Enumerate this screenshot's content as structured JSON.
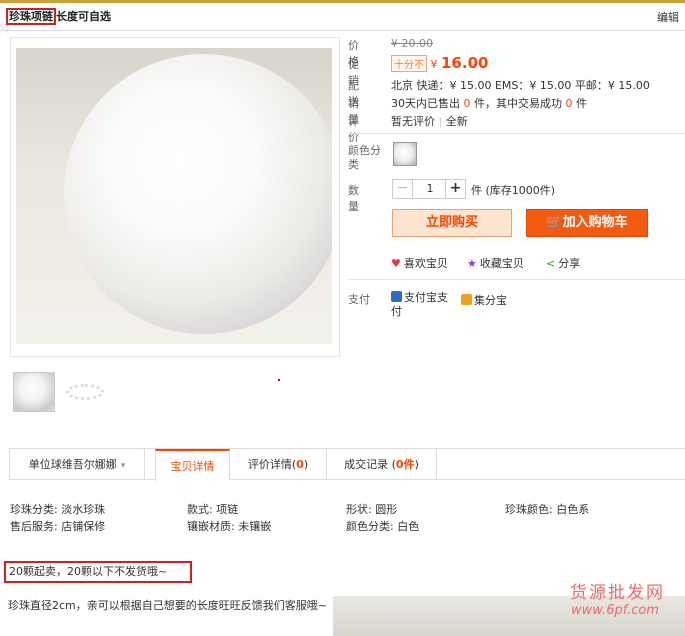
{
  "header": {
    "title_highlight": "珍珠项链",
    "title_rest": "长度可自选",
    "edit_label": "编辑"
  },
  "product": {
    "labels": {
      "price": "价格",
      "promo": "促销",
      "shipping": "配送",
      "sales": "销量",
      "review": "评价",
      "color": "颜色分类",
      "quantity": "数量",
      "pay": "支付"
    },
    "original_price": "¥ 20.00",
    "promo_tag": "十分不",
    "promo_price_symbol": "¥",
    "promo_price": "16.00",
    "shipping_text": "北京 快递：¥ 15.00  EMS：¥ 15.00  平邮：¥ 15.00",
    "sales_prefix": "30天内已售出",
    "sales_count": "0",
    "sales_mid": "件，其中交易成功",
    "sales_success": "0",
    "sales_suffix": "件",
    "review_text": "暂无评价",
    "review_link": "全新",
    "quantity_minus": "−",
    "quantity_value": "1",
    "quantity_plus": "+",
    "stock_text": "件 (库存1000件)",
    "buy_now": "立即购买",
    "add_to_cart": "加入购物车",
    "like": "喜欢宝贝",
    "favorite": "收藏宝贝",
    "share": "分享",
    "pay_alipay": "支付宝支付",
    "pay_jifen": "集分宝"
  },
  "tabs": {
    "shop": "单位球维吾尔娜娜",
    "detail": "宝贝详情",
    "review_label": "评价详情",
    "review_count": "0",
    "trade_label": "成交记录",
    "trade_count": "0",
    "trade_unit": "件"
  },
  "attributes": [
    "珍珠分类: 淡水珍珠",
    "款式: 项链",
    "形状: 圆形",
    "珍珠颜色: 白色系",
    "售后服务: 店铺保修",
    "镶嵌材质: 未镶嵌",
    "颜色分类: 白色"
  ],
  "description": {
    "notice": "20颗起卖，20颗以下不发货哦~",
    "body": "珍珠直径2cm，亲可以根据自己想要的长度旺旺反馈我们客服哦~",
    "watermark_cn": "货源批发网",
    "watermark_url": "www.6pf.com"
  },
  "colors": {
    "accent": "#ff4400",
    "highlight_border": "#d02020"
  }
}
